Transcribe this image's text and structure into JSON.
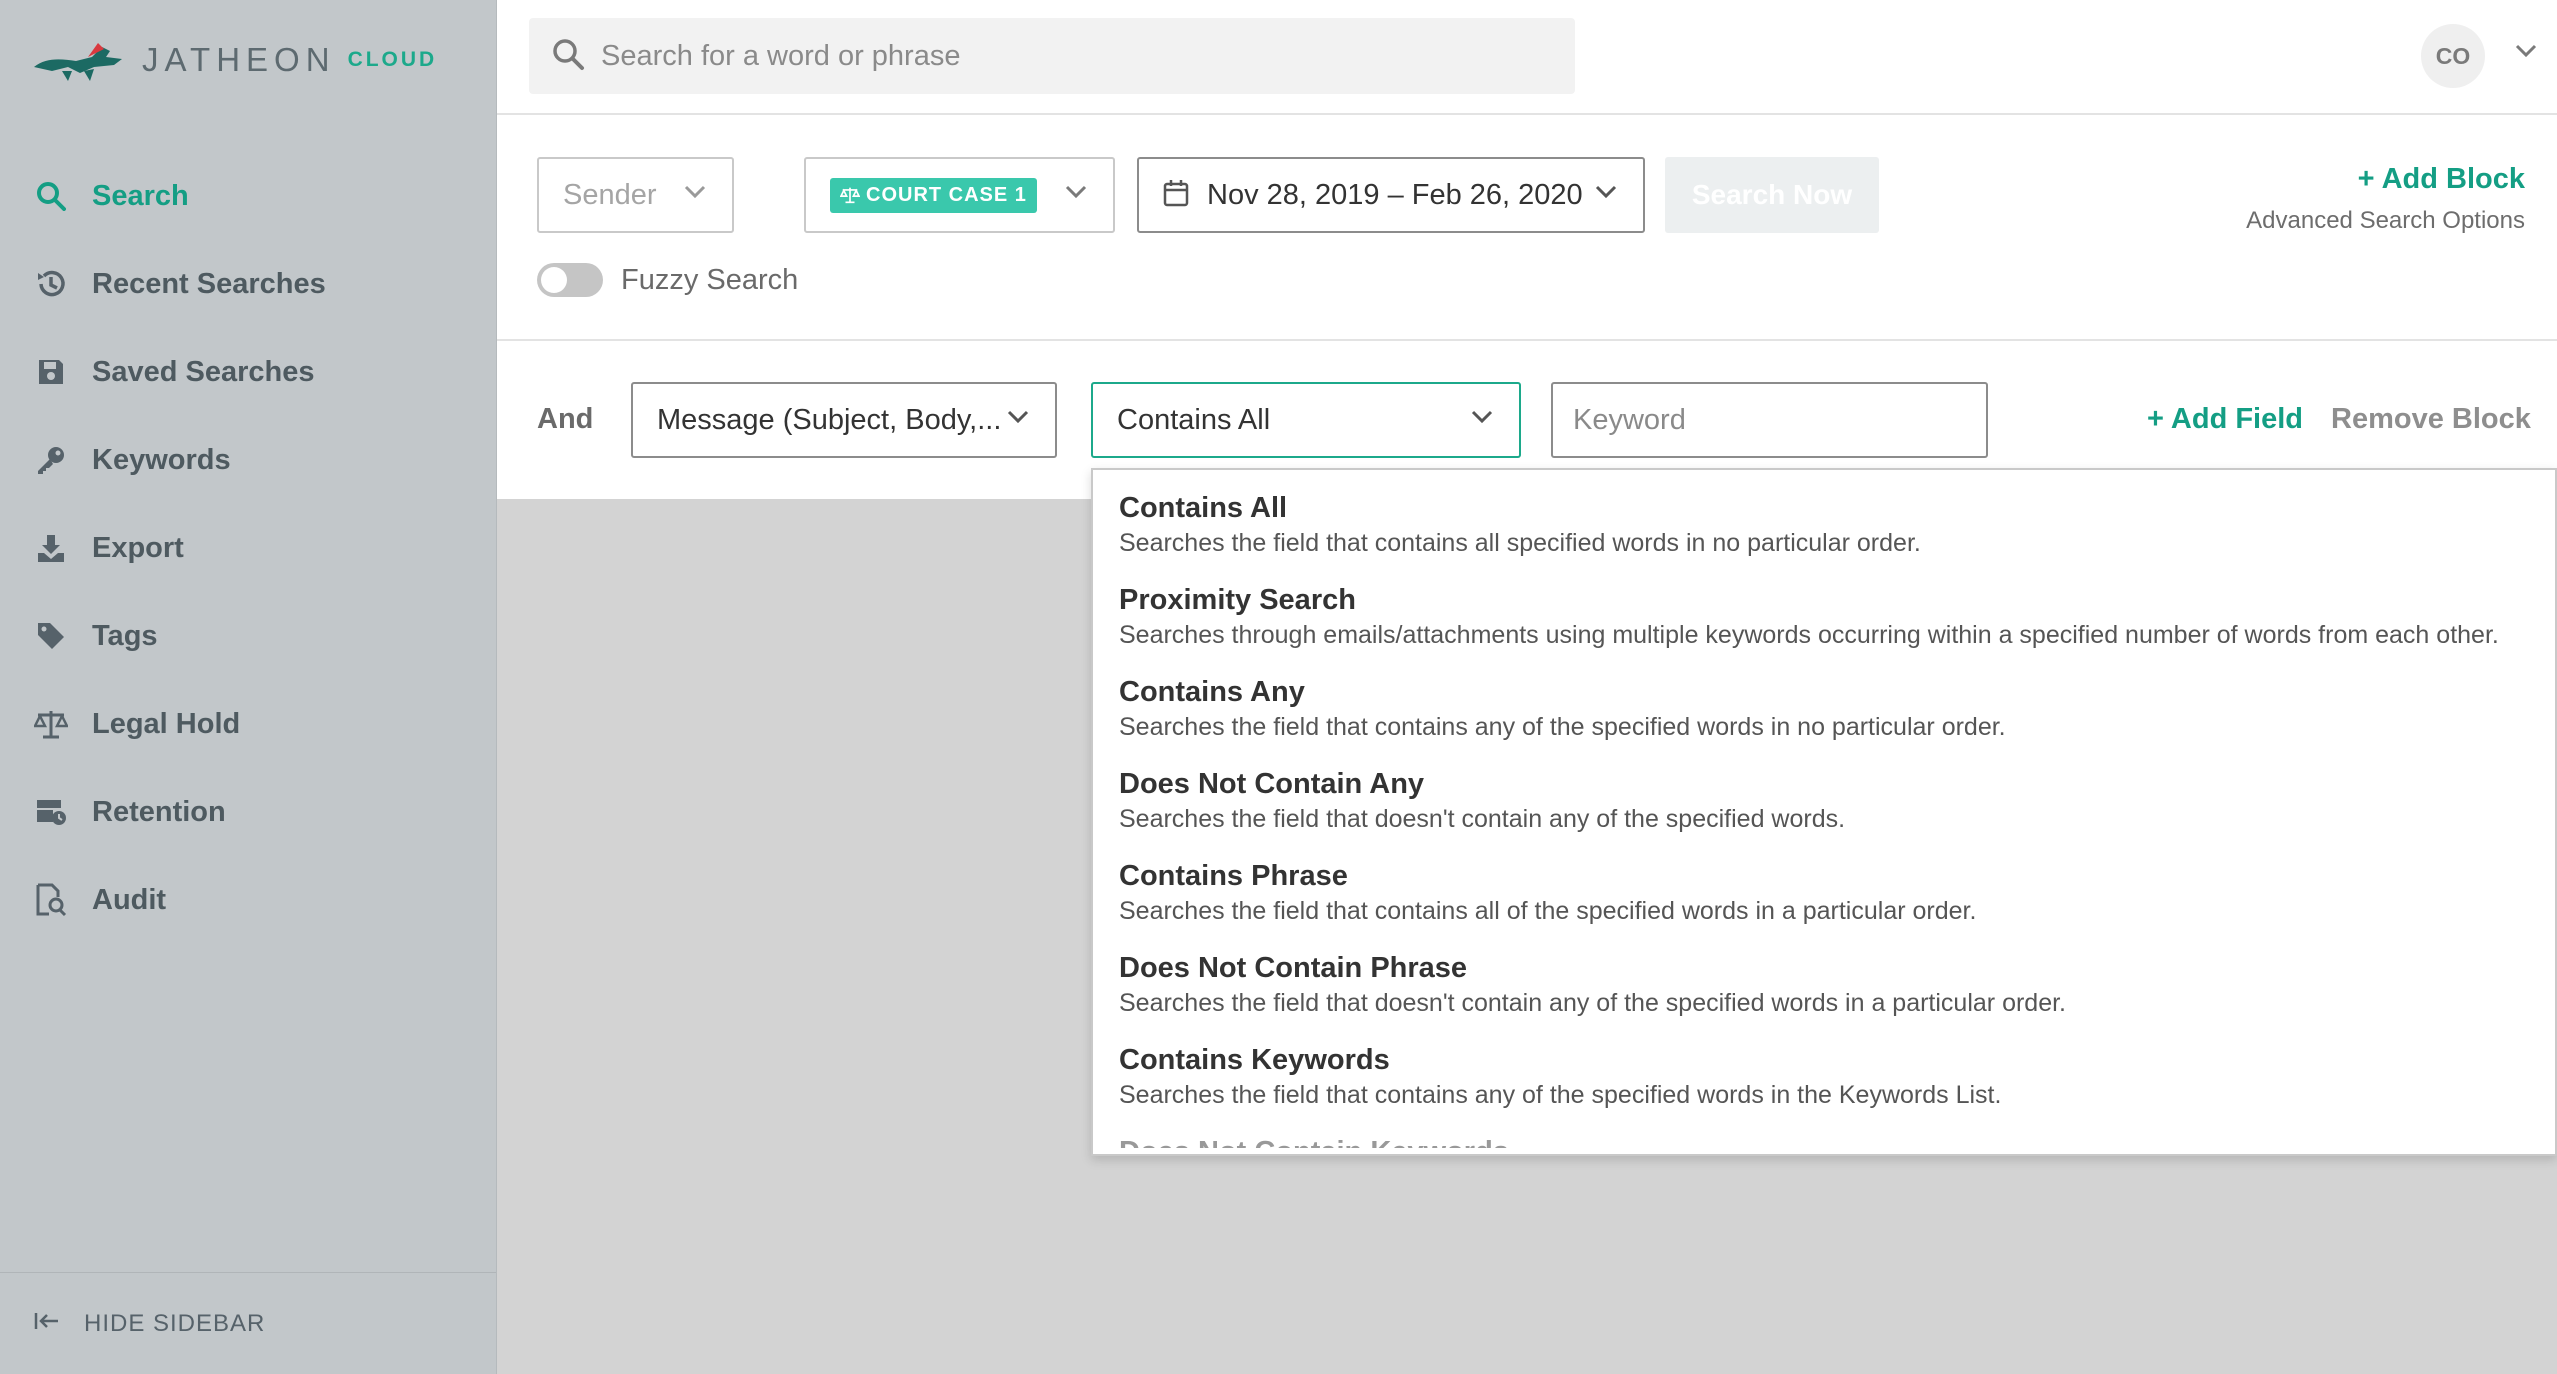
{
  "brand": {
    "name": "JATHEON",
    "suffix": "CLOUD"
  },
  "sidebar": {
    "items": [
      {
        "label": "Search",
        "icon": "search-icon"
      },
      {
        "label": "Recent Searches",
        "icon": "history-icon"
      },
      {
        "label": "Saved Searches",
        "icon": "save-icon"
      },
      {
        "label": "Keywords",
        "icon": "key-icon"
      },
      {
        "label": "Export",
        "icon": "download-icon"
      },
      {
        "label": "Tags",
        "icon": "tag-icon"
      },
      {
        "label": "Legal Hold",
        "icon": "scale-icon"
      },
      {
        "label": "Retention",
        "icon": "retention-icon"
      },
      {
        "label": "Audit",
        "icon": "audit-icon"
      }
    ],
    "footer": "HIDE SIDEBAR"
  },
  "topbar": {
    "search_placeholder": "Search for a word or phrase",
    "avatar_initials": "CO"
  },
  "filters": {
    "sender": "Sender",
    "court_case": "COURT CASE 1",
    "date_range": "Nov 28, 2019 – Feb 26, 2020",
    "search_now": "Search Now",
    "add_block": "+ Add Block",
    "advanced": "Advanced Search Options",
    "fuzzy": "Fuzzy Search"
  },
  "block": {
    "operator": "And",
    "field": "Message (Subject, Body,...",
    "condition": "Contains All",
    "keyword_placeholder": "Keyword",
    "add_field": "+ Add Field",
    "remove_block": "Remove Block"
  },
  "dropdown": {
    "options": [
      {
        "title": "Contains All",
        "desc": "Searches the field that contains all specified words in no particular order."
      },
      {
        "title": "Proximity Search",
        "desc": "Searches through emails/attachments using multiple keywords occurring within a specified number of words from each other."
      },
      {
        "title": "Contains Any",
        "desc": "Searches the field that contains any of the specified words in no particular order."
      },
      {
        "title": "Does Not Contain Any",
        "desc": "Searches the field that doesn't contain any of the specified words."
      },
      {
        "title": "Contains Phrase",
        "desc": "Searches the field that contains all of the specified words in a particular order."
      },
      {
        "title": "Does Not Contain Phrase",
        "desc": "Searches the field that doesn't contain any of the specified words in a particular order."
      },
      {
        "title": "Contains Keywords",
        "desc": "Searches the field that contains any of the specified words in the Keywords List."
      }
    ],
    "partial_option": "Does Not Contain Keywords"
  },
  "colors": {
    "accent": "#149e84",
    "sidebar_bg": "#c2c7ca",
    "badge": "#3ac8ac"
  }
}
